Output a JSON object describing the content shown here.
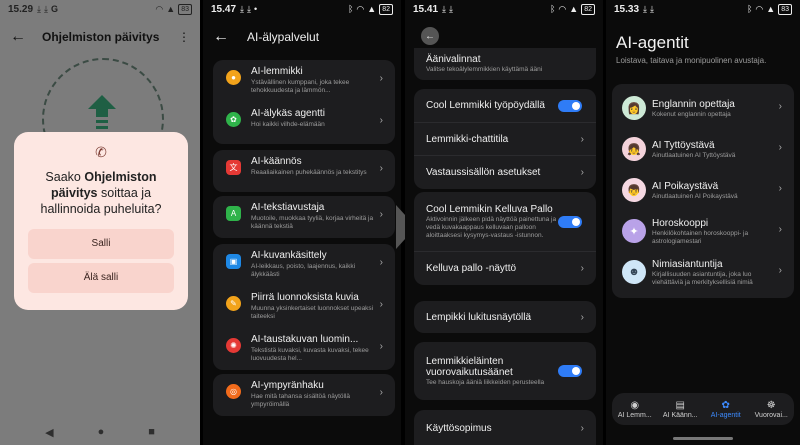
{
  "screen1": {
    "status": {
      "time": "15.29",
      "extra": "G",
      "battery": "83"
    },
    "title": "Ohjelmiston päivitys",
    "dialog": {
      "line1": "Saako",
      "app_name": "Ohjelmiston päivitys",
      "line2": "soittaa ja hallinnoida puheluita?",
      "allow": "Salli",
      "deny": "Älä salli"
    }
  },
  "screen2": {
    "status": {
      "time": "15.47",
      "battery": "82"
    },
    "title": "AI-älypalvelut",
    "items": [
      {
        "title": "AI-lemmikki",
        "desc": "Ystävällinen kumppani, joka tekee tehokkuudesta ja lämmön...",
        "color": "#f2a31b",
        "icon": "paw-icon"
      },
      {
        "title": "AI-älykäs agentti",
        "desc": "Hoi kaikki vilhde-elämään",
        "color": "#2fb34a",
        "icon": "agent-icon"
      },
      {
        "title": "AI-käännös",
        "desc": "Reaaliaikainen puhekäännös ja tekstitys",
        "color": "#e53935",
        "icon": "translate-icon"
      },
      {
        "title": "AI-tekstiavustaja",
        "desc": "Muotoile, muokkaa tyyliä, korjaa virheitä ja käännä tekstiä",
        "color": "#2fb34a",
        "icon": "text-icon"
      },
      {
        "title": "AI-kuvankäsittely",
        "desc": "AI-leikkaus, poisto, laajennus, kaikki älykkäästi",
        "color": "#1e88e5",
        "icon": "image-icon"
      },
      {
        "title": "Piirrä luonnoksista kuvia",
        "desc": "Muunna yksinkertaiset luonnokset upeaksi taiteeksi",
        "color": "#f2a31b",
        "icon": "pencil-icon"
      },
      {
        "title": "AI-taustakuvan luomin...",
        "desc": "Tekstistä kuvaksi, kuvasta kuvaksi, tekee luovuudesta hel...",
        "color": "#e53935",
        "icon": "wallpaper-icon"
      },
      {
        "title": "AI-ympyränhaku",
        "desc": "Hae mitä tahansa sisältöä näytöllä ympyröimällä",
        "color": "#f26b1b",
        "icon": "circle-search-icon"
      }
    ]
  },
  "screen3": {
    "status": {
      "time": "15.41",
      "battery": "82"
    },
    "top_item": {
      "title": "Äänivalinnat",
      "desc": "Valitse tekoälylemmikkien käyttämä ääni"
    },
    "group1": [
      "Cool Lemmikki työpöydällä",
      "Lemmikki-chattitila",
      "Vastaussisällön asetukset"
    ],
    "group2": [
      {
        "title": "Cool Lemmikin Kelluva Pallo",
        "desc": "Aktivoinnin jälkeen pidä näyttöä painettuna ja vedä kuvakaappaus kelluvaan palloon aloittaaksesi kysymys-vastaus -istunnon."
      },
      {
        "title": "Kelluva pallo -näyttö"
      }
    ],
    "lock": "Lempikki lukitusnäytöllä",
    "sounds": {
      "title": "Lemmikkieläinten vuorovaikutusäänet",
      "desc": "Tee hauskoja ääniä liikkeiden perusteella"
    },
    "terms": "Käyttösopimus"
  },
  "screen4": {
    "status": {
      "time": "15.33",
      "battery": "83"
    },
    "title": "AI-agentit",
    "subtitle": "Loistava, taitava ja monipuolinen avustaja.",
    "agents": [
      {
        "title": "Englannin opettaja",
        "desc": "Kokenut englannin opettaja",
        "bg": "#cde9d6",
        "glyph": "👩"
      },
      {
        "title": "AI Tyttöystävä",
        "desc": "Ainutlaatuinen AI Tyttöystävä",
        "bg": "#f4d3db",
        "glyph": "👧"
      },
      {
        "title": "AI Poikaystävä",
        "desc": "Ainutlaatuinen AI Poikaystävä",
        "bg": "#f5d8e2",
        "glyph": "👦"
      },
      {
        "title": "Horoskooppi",
        "desc": "Henkilökohtainen horoskooppi- ja astrologiamestari",
        "bg": "#b9a2e8",
        "glyph": "✦"
      },
      {
        "title": "Nimiasiantuntija",
        "desc": "Kirjallisuuden asiantuntija, joka luo viehättäviä ja merkityksellisiä nimiä",
        "bg": "#cfe6f7",
        "glyph": "☻"
      }
    ],
    "tabs": [
      {
        "label": "AI Lemm...",
        "icon": "pet-tab-icon"
      },
      {
        "label": "AI Käänn...",
        "icon": "translate-tab-icon"
      },
      {
        "label": "AI-agentit",
        "icon": "agents-tab-icon",
        "active": true
      },
      {
        "label": "Vuorovai...",
        "icon": "interaction-tab-icon"
      }
    ]
  }
}
